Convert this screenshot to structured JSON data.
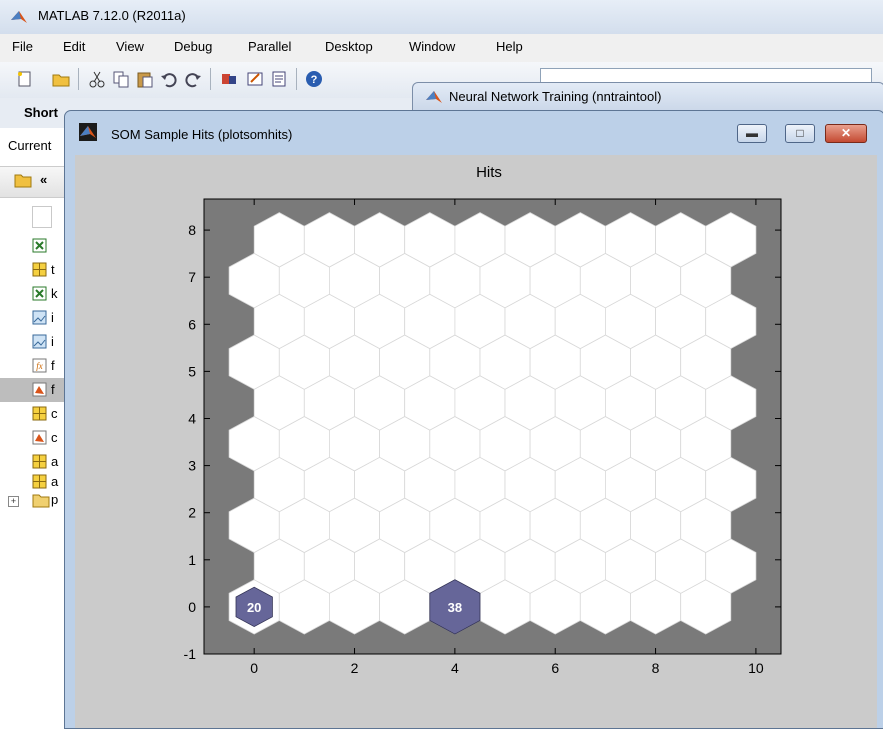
{
  "matlab": {
    "title": "MATLAB  7.12.0 (R2011a)",
    "menu": [
      "File",
      "Edit",
      "View",
      "Debug",
      "Parallel",
      "Desktop",
      "Window",
      "Help"
    ],
    "shortcuts_label": "Short",
    "toolbar_icons": [
      "new-file-icon",
      "open-folder-icon",
      "cut-icon",
      "copy-icon",
      "paste-icon",
      "undo-icon",
      "redo-icon",
      "simulink-icon",
      "guide-icon",
      "profiler-icon",
      "help-icon"
    ],
    "current_folder_label": "Current",
    "folder_back": "«",
    "file_letters": [
      "",
      "t",
      "k",
      "i",
      "i",
      "f",
      "f",
      "c",
      "c",
      "a",
      "a"
    ],
    "tree_item_letter": "p"
  },
  "nntool": {
    "title": "Neural Network Training (nntraintool)"
  },
  "som": {
    "title": "SOM Sample Hits (plotsomhits)",
    "plot_title": "Hits",
    "colors": {
      "background": "#7a7a7a",
      "hex_fill": "#ffffff",
      "hit_fill": "#666699",
      "hit_text": "#ffffff",
      "axes_bg": "#cbcbcb"
    }
  },
  "chart_data": {
    "type": "heatmap",
    "title": "Hits",
    "grid": "10x10 hexagonal",
    "xlim": [
      -1,
      10.5
    ],
    "ylim": [
      -1,
      8.66
    ],
    "xticks": [
      0,
      2,
      4,
      6,
      8,
      10
    ],
    "yticks": [
      -1,
      0,
      1,
      2,
      3,
      4,
      5,
      6,
      7,
      8
    ],
    "hits": [
      {
        "x": 0,
        "y": 0,
        "count": 20
      },
      {
        "x": 4,
        "y": 0,
        "count": 38
      }
    ],
    "max_hits": 38
  }
}
